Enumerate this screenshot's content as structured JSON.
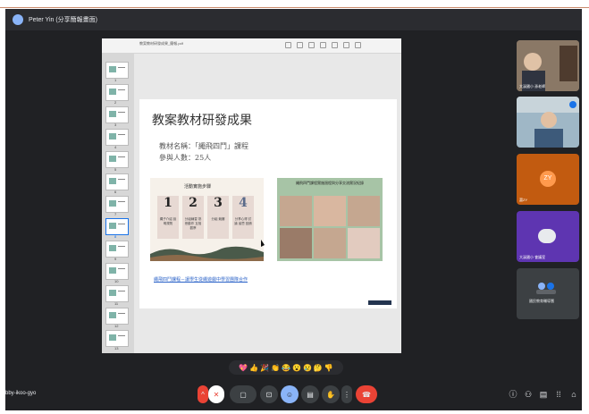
{
  "window": {
    "presenter_label": "Peter Yin (分享簡報畫面)"
  },
  "viewer": {
    "file_name": "教案教材研發成果_簡報.pdf"
  },
  "thumbnails": {
    "page_numbers": [
      "1",
      "2",
      "3",
      "4",
      "5",
      "6",
      "7",
      "8",
      "9",
      "10",
      "11",
      "12",
      "13"
    ],
    "selected_index": 7
  },
  "slide": {
    "title": "教案教材研發成果",
    "line1": "教材名稱：「繩飛四鬥」課程",
    "line2": "參與人數：25人",
    "panel_title": "活動實施步驟",
    "steps": [
      {
        "num": "1",
        "label": "繩子介紹 說明規則"
      },
      {
        "num": "2",
        "label": "分組練習 熟悉動作 互相觀摩"
      },
      {
        "num": "3",
        "label": "分組 競賽"
      },
      {
        "num": "4",
        "label": "分享心得 討論 省思 回饋"
      }
    ],
    "photo_caption": "繩飛四鬥課程實施過程與分享交流實況紀錄",
    "link_text": "繩飛四鬥課程－讓學生從繩遊戲中學習團隊合作"
  },
  "participants": [
    {
      "name": "大溪國小 孫老師",
      "initials": ""
    },
    {
      "name": "",
      "initials": ""
    },
    {
      "name": "蕭ZY",
      "initials": "ZY"
    },
    {
      "name": "大溪國小 會議室",
      "initials": ""
    },
    {
      "name": "",
      "initials": ""
    }
  ],
  "extra_tile": {
    "label": "國民教育輔導團"
  },
  "reactions": [
    "💖",
    "👍",
    "🎉",
    "👏",
    "😂",
    "😮",
    "😢",
    "🤔",
    "👎"
  ],
  "meeting": {
    "code": "bby-ikoo-gyo"
  },
  "colors": {
    "meet_bg": "#202124",
    "end_call": "#ea4335",
    "active": "#8ab4f8",
    "accent_blue": "#1a73e8"
  },
  "controls": {
    "mic_icon": "mic-off-icon",
    "camera_icon": "camera-icon",
    "captions_icon": "captions-icon",
    "emoji_icon": "emoji-icon",
    "present_icon": "present-icon",
    "hand_icon": "raise-hand-icon",
    "more_icon": "more-icon",
    "end_icon": "end-call-icon"
  }
}
